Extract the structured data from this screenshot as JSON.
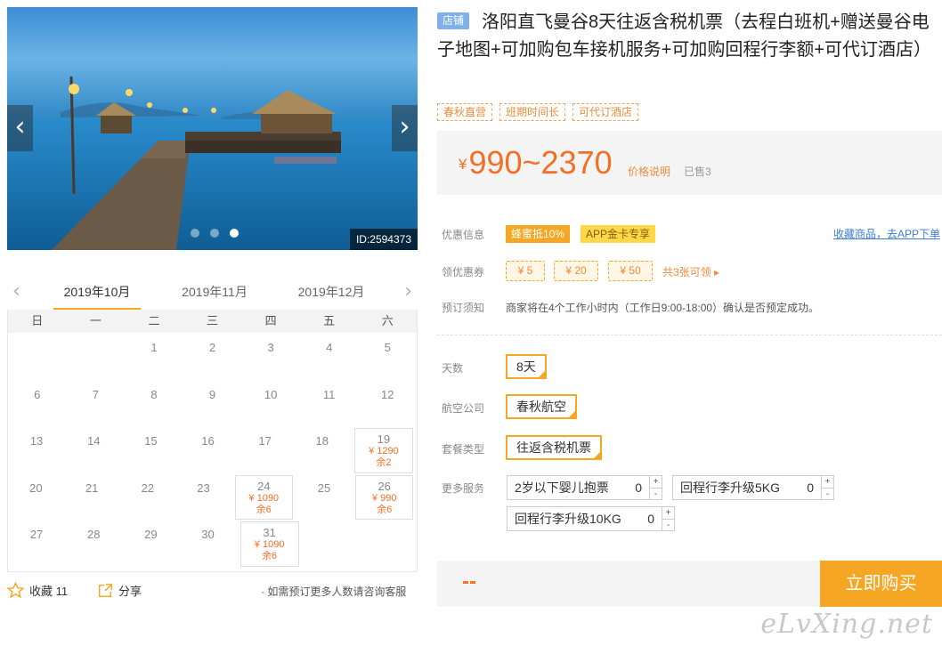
{
  "gallery": {
    "image_id": "ID:2594373",
    "prev_icon": "chevron-left-icon",
    "next_icon": "chevron-right-icon",
    "slide_count": 3,
    "active_slide": 3
  },
  "calendar": {
    "months": [
      "2019年10月",
      "2019年11月",
      "2019年12月"
    ],
    "active_month": "2019年10月",
    "weekdays": [
      "日",
      "一",
      "二",
      "三",
      "四",
      "五",
      "六"
    ],
    "weeks": [
      [
        {
          "d": ""
        },
        {
          "d": ""
        },
        {
          "d": "1"
        },
        {
          "d": "2"
        },
        {
          "d": "3"
        },
        {
          "d": "4"
        },
        {
          "d": "5"
        }
      ],
      [
        {
          "d": "6"
        },
        {
          "d": "7"
        },
        {
          "d": "8"
        },
        {
          "d": "9"
        },
        {
          "d": "10"
        },
        {
          "d": "11"
        },
        {
          "d": "12"
        }
      ],
      [
        {
          "d": "13"
        },
        {
          "d": "14"
        },
        {
          "d": "15"
        },
        {
          "d": "16"
        },
        {
          "d": "17"
        },
        {
          "d": "18"
        },
        {
          "d": "19",
          "price": "¥ 1290",
          "left": "余2"
        }
      ],
      [
        {
          "d": "20"
        },
        {
          "d": "21"
        },
        {
          "d": "22"
        },
        {
          "d": "23"
        },
        {
          "d": "24",
          "price": "¥ 1090",
          "left": "余6"
        },
        {
          "d": "25"
        },
        {
          "d": "26",
          "price": "¥ 990",
          "left": "余6"
        }
      ],
      [
        {
          "d": "27"
        },
        {
          "d": "28"
        },
        {
          "d": "29"
        },
        {
          "d": "30"
        },
        {
          "d": "31",
          "price": "¥ 1090",
          "left": "余6"
        },
        {
          "d": ""
        },
        {
          "d": ""
        }
      ]
    ]
  },
  "actions": {
    "favorite_label": "收藏 11",
    "share_label": "分享",
    "tip": "· 如需预订更多人数请咨询客服"
  },
  "product": {
    "shop_badge": "店铺",
    "title": "洛阳直飞曼谷8天往返含税机票（去程白班机+赠送曼谷电子地图+可加购包车接机服务+可加购回程行李额+可代订酒店）",
    "tags": [
      "春秋直营",
      "班期时间长",
      "可代订酒店"
    ],
    "price_currency": "¥",
    "price_range": "990~2370",
    "price_note": "价格说明",
    "sold": "已售3"
  },
  "promotions": {
    "label": "优惠信息",
    "badge1": "蜂蜜抵10%",
    "badge2": "APP金卡专享",
    "link": "收藏商品，去APP下单",
    "coupon_label": "领优惠券",
    "coupons": [
      "¥ 5",
      "¥ 20",
      "¥ 50"
    ],
    "coupon_count": "共3张可领 ▸",
    "notice_label": "预订须知",
    "notice": "商家将在4个工作小时内（工作日9:00-18:00）确认是否预定成功。"
  },
  "options": {
    "days_label": "天数",
    "days_value": "8天",
    "airline_label": "航空公司",
    "airline_value": "春秋航空",
    "package_label": "套餐类型",
    "package_value": "往返含税机票",
    "services_label": "更多服务",
    "services": [
      {
        "name": "2岁以下婴儿抱票",
        "qty": "0"
      },
      {
        "name": "回程行李升级5KG",
        "qty": "0"
      },
      {
        "name": "回程行李升级10KG",
        "qty": "0"
      }
    ],
    "plus": "+",
    "minus": "-"
  },
  "buy": {
    "price": "--",
    "button": "立即购买"
  },
  "watermark": "eLvXing.net",
  "colors": {
    "accent": "#f5a623",
    "price": "#f36f26",
    "link": "#3a7ed8",
    "shop_badge": "#7fb0ea"
  }
}
